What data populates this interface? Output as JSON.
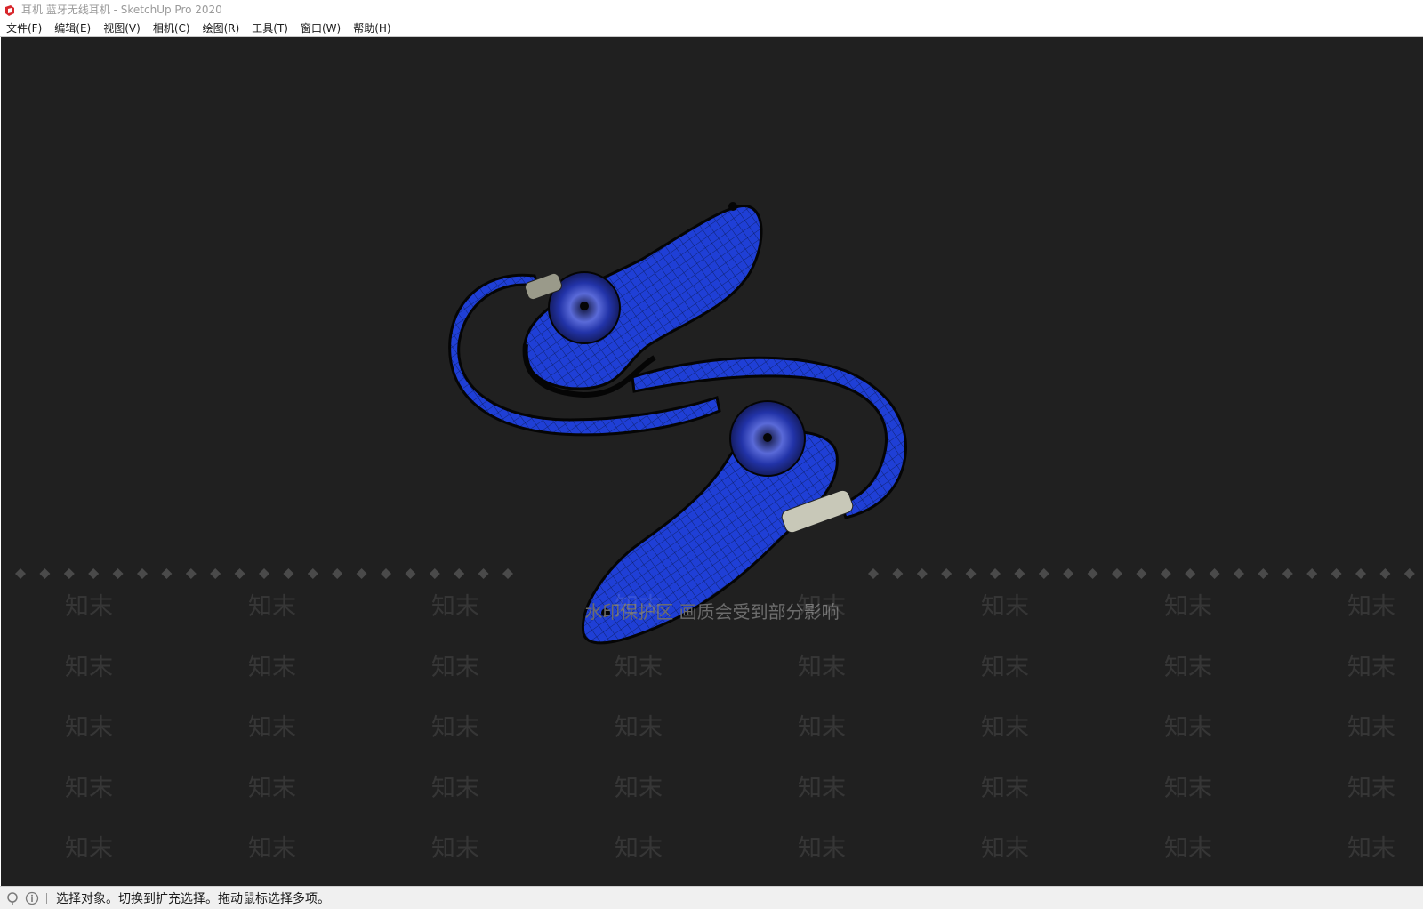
{
  "window": {
    "title": "耳机 蓝牙无线耳机 - SketchUp Pro 2020"
  },
  "menu": {
    "items": [
      {
        "label": "文件(F)"
      },
      {
        "label": "编辑(E)"
      },
      {
        "label": "视图(V)"
      },
      {
        "label": "相机(C)"
      },
      {
        "label": "绘图(R)"
      },
      {
        "label": "工具(T)"
      },
      {
        "label": "窗口(W)"
      },
      {
        "label": "帮助(H)"
      }
    ]
  },
  "viewport": {
    "background_color": "#202020",
    "model_color": "#1f3fd6",
    "watermark_notice": "水印保护区  画质会受到部分影响",
    "watermark_text": "知末"
  },
  "statusbar": {
    "message": "选择对象。切换到扩充选择。拖动鼠标选择多项。",
    "icons": [
      "geo-location-icon",
      "info-icon"
    ]
  }
}
